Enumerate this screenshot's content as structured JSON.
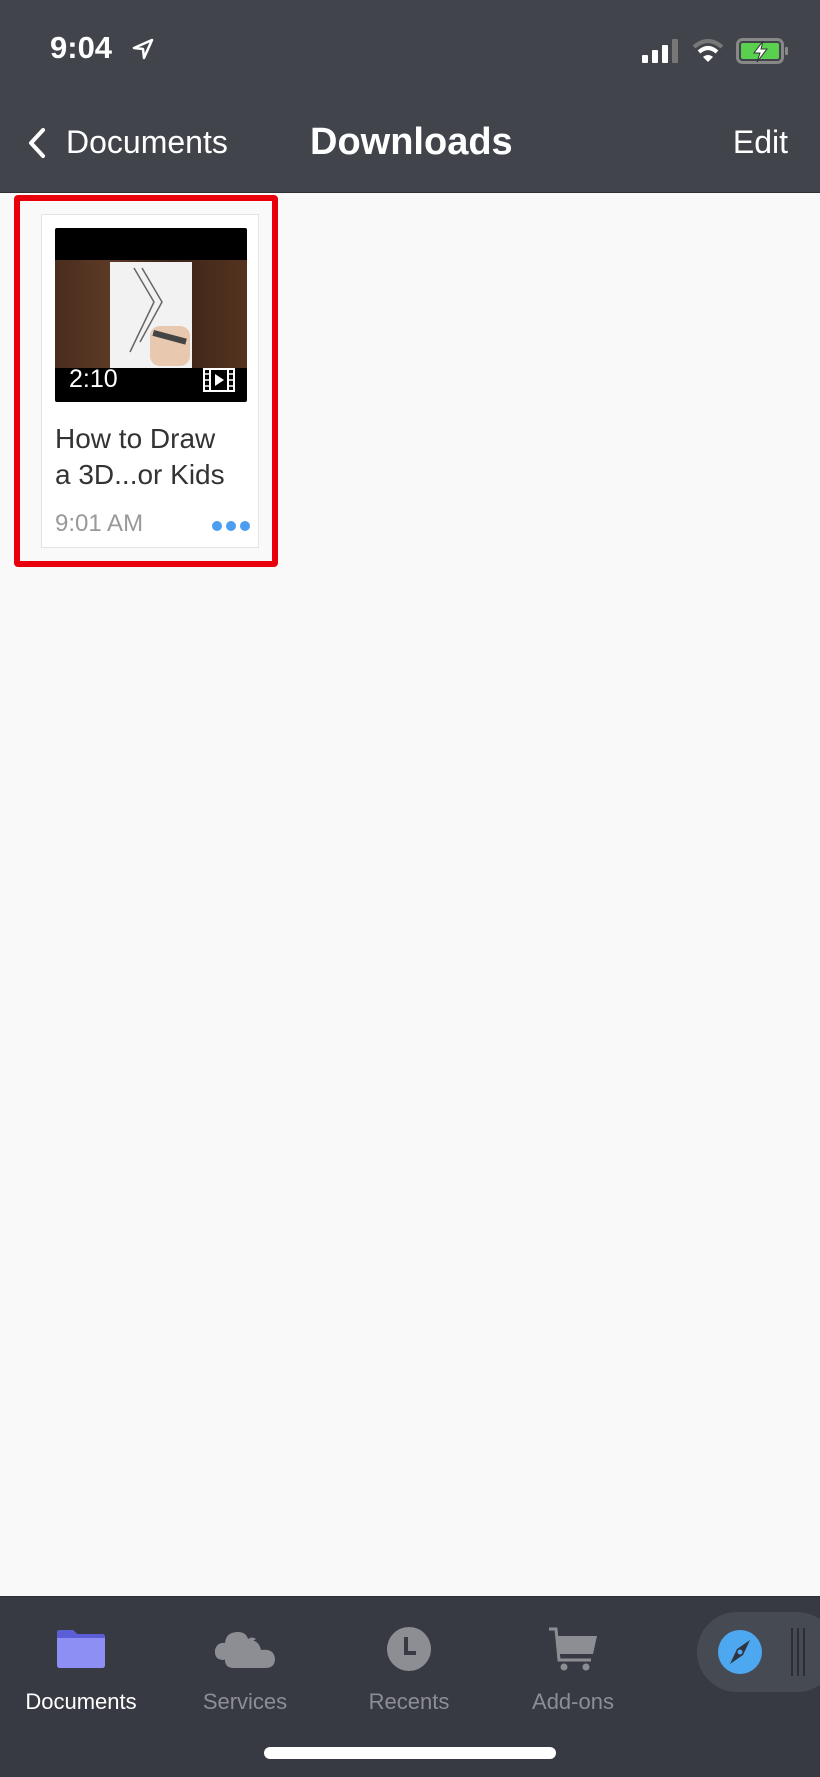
{
  "status_bar": {
    "time": "9:04"
  },
  "nav": {
    "back_label": "Documents",
    "title": "Downloads",
    "edit_label": "Edit"
  },
  "files": [
    {
      "title_line1": "How to Draw",
      "title_line2": "a 3D...or Kids",
      "time": "9:01 AM",
      "duration": "2:10",
      "type_icon": "video-icon"
    }
  ],
  "tabbar": {
    "items": [
      {
        "label": "Documents",
        "icon": "folder-icon",
        "active": true
      },
      {
        "label": "Services",
        "icon": "cloud-icon"
      },
      {
        "label": "Recents",
        "icon": "clock-icon"
      },
      {
        "label": "Add-ons",
        "icon": "cart-icon"
      }
    ]
  },
  "colors": {
    "accent": "#4a9df0",
    "highlight": "#e8000d",
    "folder": "#8d8ff5"
  }
}
